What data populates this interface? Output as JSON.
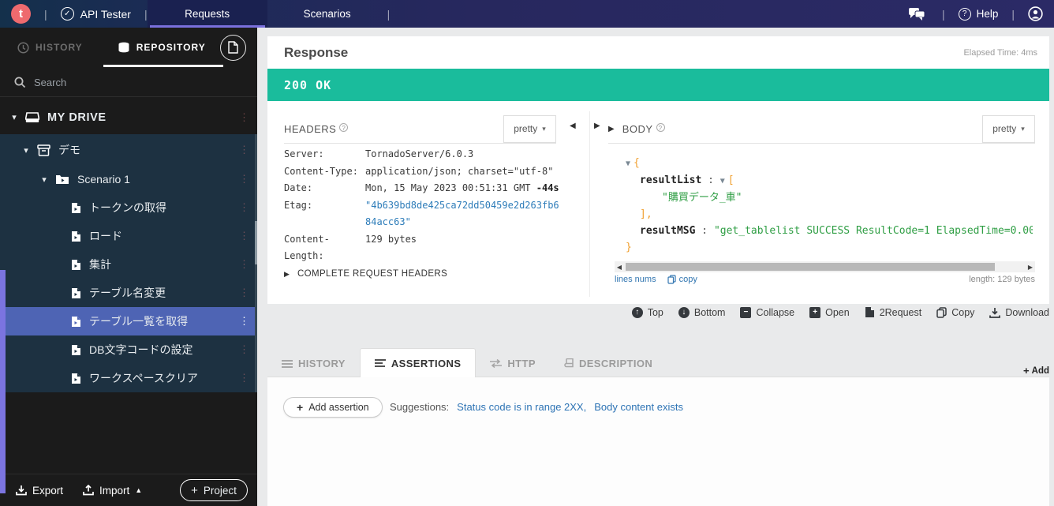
{
  "topbar": {
    "logo_letter": "t",
    "app_name": "API Tester",
    "tabs": [
      {
        "label": "Requests",
        "active": true
      },
      {
        "label": "Scenarios",
        "active": false
      }
    ],
    "help_label": "Help"
  },
  "sidebar": {
    "tabs": {
      "history": "HISTORY",
      "repository": "REPOSITORY"
    },
    "search_placeholder": "Search",
    "drive_label": "MY DRIVE",
    "tree": [
      {
        "label": "デモ",
        "level": 1,
        "type": "project",
        "expanded": true
      },
      {
        "label": "Scenario 1",
        "level": 2,
        "type": "scenario",
        "expanded": true
      },
      {
        "label": "トークンの取得",
        "level": 3,
        "type": "request"
      },
      {
        "label": "ロード",
        "level": 3,
        "type": "request"
      },
      {
        "label": "集計",
        "level": 3,
        "type": "request"
      },
      {
        "label": "テーブル名変更",
        "level": 3,
        "type": "request"
      },
      {
        "label": "テーブル一覧を取得",
        "level": 3,
        "type": "request",
        "selected": true
      },
      {
        "label": "DB文字コードの設定",
        "level": 3,
        "type": "request"
      },
      {
        "label": "ワークスペースクリア",
        "level": 3,
        "type": "request"
      }
    ],
    "footer": {
      "export_label": "Export",
      "import_label": "Import",
      "project_label": "Project"
    }
  },
  "response": {
    "title": "Response",
    "elapsed": "Elapsed Time: 4ms",
    "status": "200 OK",
    "headers_panel": {
      "title": "HEADERS",
      "format": "pretty",
      "rows": [
        {
          "name": "Server:",
          "value": "TornadoServer/6.0.3"
        },
        {
          "name": "Content-Type:",
          "value": "application/json; charset=\"utf-8\""
        },
        {
          "name": "Date:",
          "value": "Mon, 15 May 2023 00:51:31 GMT ",
          "suffix": "-44s"
        },
        {
          "name": "Etag:",
          "value": "\"4b639bd8de425ca72dd50459e2d263fb684acc63\""
        },
        {
          "name": "Content-Length:",
          "value": "129 bytes"
        }
      ],
      "complete_label": "COMPLETE REQUEST HEADERS"
    },
    "body_panel": {
      "title": "BODY",
      "format": "pretty",
      "json": {
        "open_brace": "{",
        "list_key": "resultList",
        "colon": ":",
        "open_bracket": "[",
        "list_item": "\"購買データ_車\"",
        "close_bracket": "],",
        "msg_key": "resultMSG",
        "msg_value": "\"get_tablelist SUCCESS ResultCode=1 ElapsedTime=0.00",
        "close_brace": "}"
      },
      "footer": {
        "lines_nums": "lines nums",
        "copy": "copy",
        "length": "length: 129 bytes"
      }
    },
    "toolbar": [
      {
        "label": "Top"
      },
      {
        "label": "Bottom"
      },
      {
        "label": "Collapse"
      },
      {
        "label": "Open"
      },
      {
        "label": "2Request"
      },
      {
        "label": "Copy"
      },
      {
        "label": "Download"
      }
    ]
  },
  "bottom_tabs": {
    "tabs": [
      {
        "label": "HISTORY",
        "active": false
      },
      {
        "label": "ASSERTIONS",
        "active": true
      },
      {
        "label": "HTTP",
        "active": false
      },
      {
        "label": "DESCRIPTION",
        "active": false
      }
    ],
    "add_label": "Add",
    "add_assertion_label": "Add assertion",
    "suggestions_label": "Suggestions:",
    "suggestions": [
      {
        "label": "Status code is in range 2XX,"
      },
      {
        "label": "Body content exists"
      }
    ]
  },
  "colors": {
    "status_success": "#1abc9c",
    "accent_purple": "#7a70dd",
    "selected_row": "#4e64b4",
    "link_blue": "#2d7cb9",
    "json_string_green": "#2f9e44",
    "json_brace_orange": "#f0a030",
    "logo_pink": "#ee6a6e"
  }
}
